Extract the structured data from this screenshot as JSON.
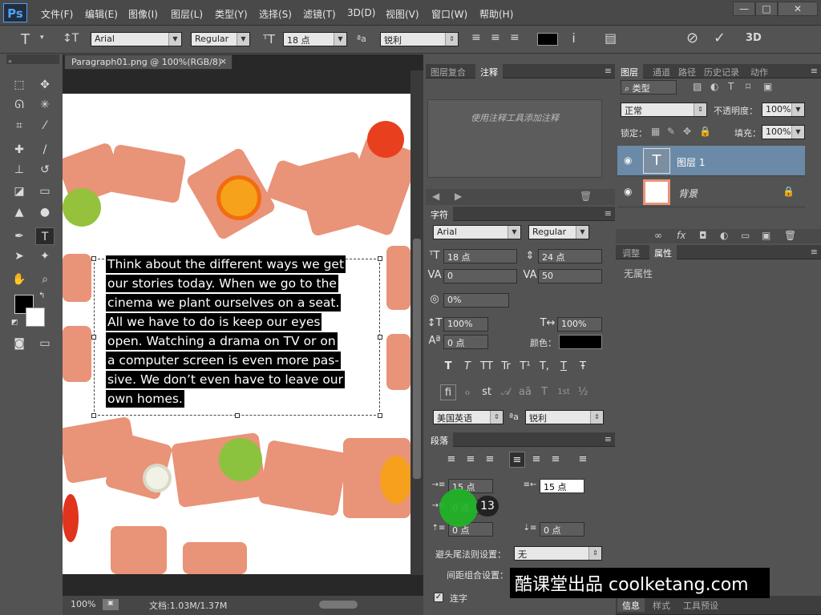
{
  "app": {
    "logo": "Ps"
  },
  "menu": [
    "文件(F)",
    "编辑(E)",
    "图像(I)",
    "图层(L)",
    "类型(Y)",
    "选择(S)",
    "滤镜(T)",
    "3D(D)",
    "视图(V)",
    "窗口(W)",
    "帮助(H)"
  ],
  "window_buttons": [
    "—",
    "□",
    "✕"
  ],
  "options": {
    "tool_glyph": "T",
    "font_family": "Arial",
    "font_style": "Regular",
    "font_size": "18 点",
    "aa_label": "ªa",
    "antialias": "锐利",
    "color": "#000000",
    "threed_label": "3D"
  },
  "document": {
    "tab_title": "Paragraph01.png @ 100%(RGB/8)",
    "tab_close": "×",
    "text_lines": [
      "Think about the different ways we get",
      "our stories today. When we go to the",
      "cinema we plant ourselves on a seat.",
      "All we have to do is keep our eyes",
      "open. Watching a drama on TV or on",
      "a computer screen is even more pas-",
      "sive. We don’t even have to leave our",
      "own homes."
    ]
  },
  "status": {
    "zoom": "100%",
    "doc": "文档:1.03M/1.37M"
  },
  "notes_panel": {
    "tabs": [
      "图层复合",
      "注释"
    ],
    "active_tab": "注释",
    "hint": "使用注释工具添加注释"
  },
  "character_panel": {
    "title": "字符",
    "font_family": "Arial",
    "font_style": "Regular",
    "font_size": "18 点",
    "leading": "24 点",
    "kerning": "0",
    "tracking": "50",
    "scale_pct": "0%",
    "vertical_scale": "100%",
    "horizontal_scale": "100%",
    "baseline": "0 点",
    "color_label": "颜色：",
    "color": "#000000",
    "style_buttons": [
      "T",
      "T",
      "TT",
      "Tr",
      "T¹",
      "T,",
      "T",
      "Ŧ"
    ],
    "opentype_buttons": [
      "fi",
      "ℴ",
      "st",
      "𝒜",
      "aā",
      "T",
      "1st",
      "½"
    ],
    "language": "美国英语",
    "aa_label": "ªa",
    "antialias": "锐利"
  },
  "paragraph_panel": {
    "title": "段落",
    "indent_left": "15 点",
    "indent_right": "15 点",
    "indent_first": "0 点",
    "space_before": "0 点",
    "space_after": "0 点",
    "hyphen_label": "避头尾法则设置：",
    "hyphen_value": "无",
    "spacing_label": "间距组合设置：",
    "hyphenate_label": "连字",
    "hyphenate": true
  },
  "layers_panel": {
    "tabs": [
      "图层",
      "通道",
      "路径",
      "历史记录",
      "动作"
    ],
    "active_tab": "图层",
    "filter": "类型",
    "blend": "正常",
    "opacity_label": "不透明度：",
    "opacity": "100%",
    "lock_label": "锁定：",
    "fill_label": "填充：",
    "fill": "100%",
    "layers": [
      {
        "name": "图层 1",
        "selected": true,
        "thumb": "T"
      },
      {
        "name": "背景",
        "selected": false,
        "locked": true
      }
    ],
    "footer_icons": [
      "∞",
      "fx",
      "◘",
      "◐",
      "▭",
      "▣",
      "🗑"
    ]
  },
  "properties_panel": {
    "tabs": [
      "调整",
      "属性"
    ],
    "active_tab": "属性",
    "empty_text": "无属性"
  },
  "bottom_tabs": [
    "信息",
    "样式",
    "工具预设"
  ],
  "overlay": {
    "step_badge": "13",
    "watermark": "酷课堂出品 coolketang.com"
  }
}
